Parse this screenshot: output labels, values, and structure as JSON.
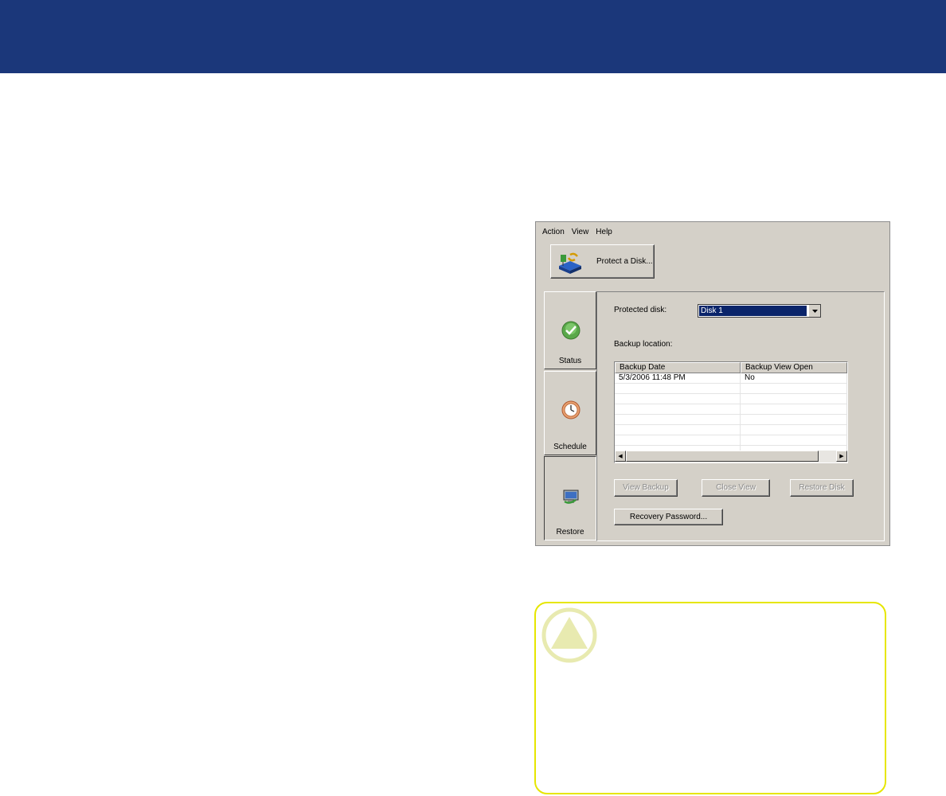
{
  "app": {
    "menu": [
      "Action",
      "View",
      "Help"
    ],
    "protect_button": "Protect a Disk...",
    "nav": {
      "status": "Status",
      "schedule": "Schedule",
      "restore": "Restore"
    },
    "protected_disk_label": "Protected disk:",
    "protected_disk_value": "Disk 1",
    "backup_location_label": "Backup location:",
    "table": {
      "columns": [
        "Backup Date",
        "Backup View Open"
      ],
      "rows": [
        [
          "5/3/2006 11:48 PM",
          "No"
        ]
      ]
    },
    "buttons": {
      "view_backup": "View Backup",
      "close_view": "Close View",
      "restore_disk": "Restore Disk",
      "recovery_password": "Recovery Password..."
    }
  },
  "colors": {
    "header_bar": "#1b377a",
    "callout_border": "#e6e600",
    "caution_icon": "#e8eab0"
  },
  "icons": {
    "protect": "disk-protect-icon",
    "status": "checkmark-icon",
    "schedule": "clock-icon",
    "restore": "restore-computer-icon",
    "caution": "caution-triangle-icon"
  }
}
